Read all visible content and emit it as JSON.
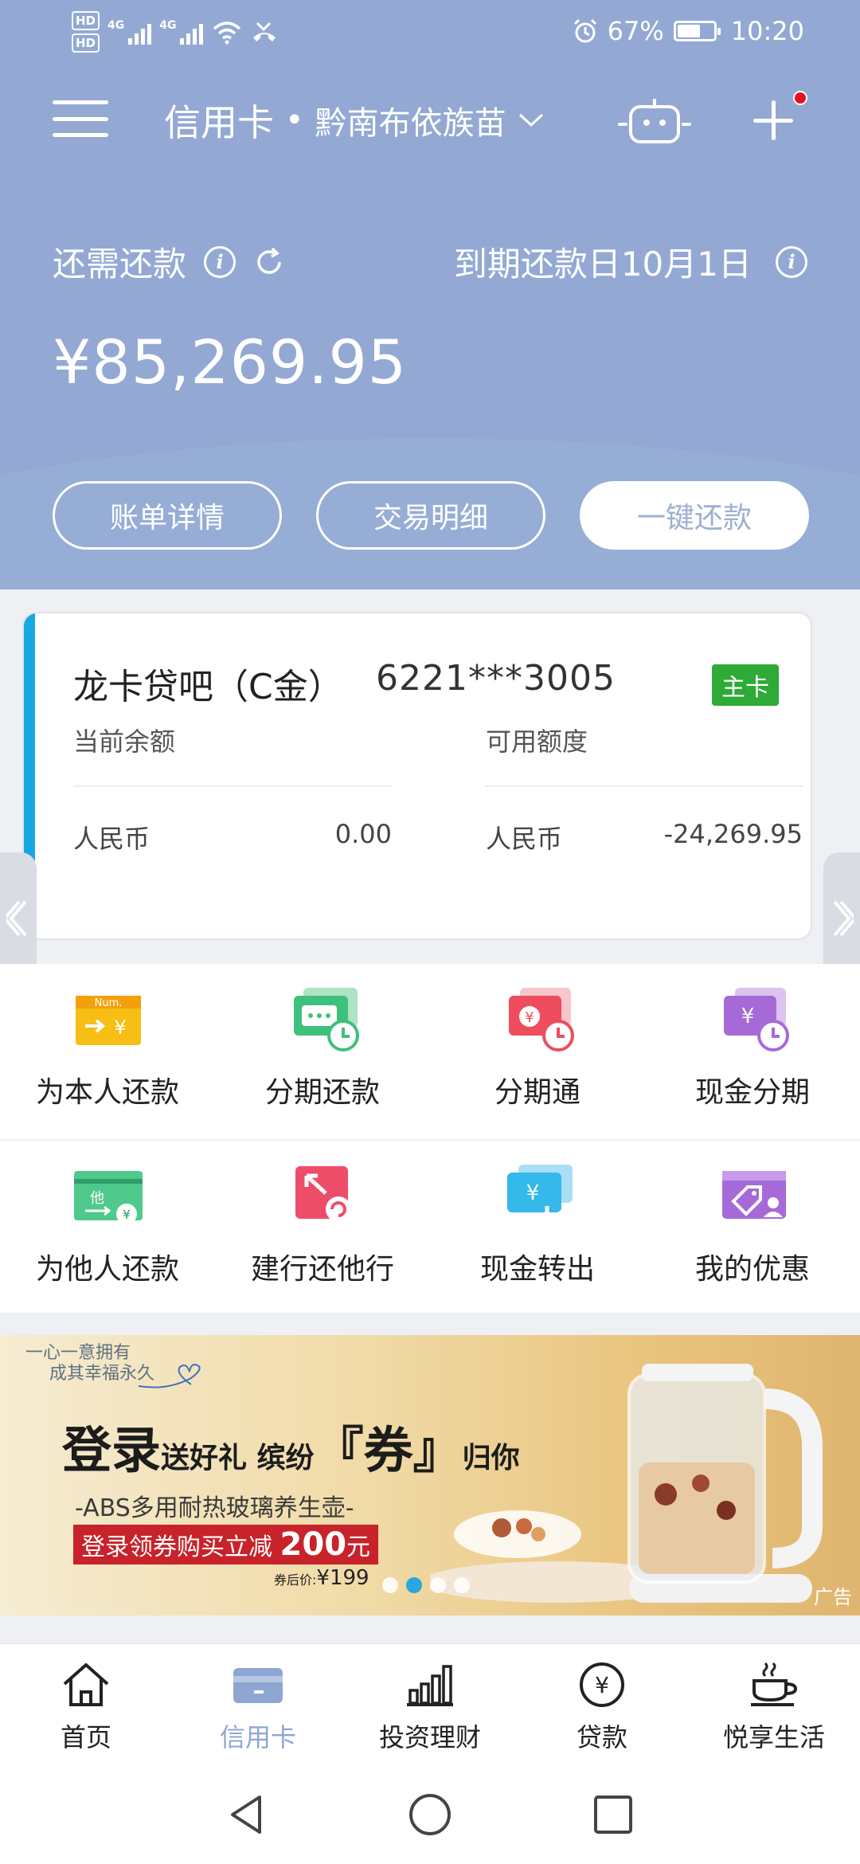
{
  "status_bar": {
    "hd1": "HD",
    "hd2": "HD",
    "network1": "4G",
    "network2": "4G",
    "battery": "67%",
    "time": "10:20"
  },
  "header": {
    "title": "信用卡",
    "separator": "•",
    "region": "黔南布依族苗",
    "due_label": "还需还款",
    "due_date": "到期还款日10月1日",
    "amount": "¥85,269.95",
    "buttons": {
      "bill_detail": "账单详情",
      "transactions": "交易明细",
      "pay_now": "一键还款"
    }
  },
  "card": {
    "name": "龙卡贷吧（C金）",
    "number": "6221***3005",
    "badge": "主卡",
    "current_balance_label": "当前余额",
    "available_credit_label": "可用额度",
    "currency": "人民币",
    "current_balance": "0.00",
    "available_credit": "-24,269.95",
    "accent_color": "#16a8e0"
  },
  "services": [
    {
      "label": "为本人还款",
      "icon": "self-repay-icon"
    },
    {
      "label": "分期还款",
      "icon": "installment-repay-icon"
    },
    {
      "label": "分期通",
      "icon": "installment-pass-icon"
    },
    {
      "label": "现金分期",
      "icon": "cash-installment-icon"
    },
    {
      "label": "为他人还款",
      "icon": "others-repay-icon"
    },
    {
      "label": "建行还他行",
      "icon": "repay-other-bank-icon"
    },
    {
      "label": "现金转出",
      "icon": "cash-transfer-icon"
    },
    {
      "label": "我的优惠",
      "icon": "my-offers-icon"
    }
  ],
  "banner": {
    "slogan_line1": "一心一意拥有",
    "slogan_line2": "成其幸福永久",
    "headline_big1": "登录",
    "headline_small1": "送好礼 缤纷",
    "headline_big2": "『券』",
    "headline_small2": "归你",
    "product": "-ABS多用耐热玻璃养生壶-",
    "offer_prefix": "登录领券购买立减",
    "offer_amount": "200",
    "offer_suffix": "元",
    "price_label": "券后价:",
    "price": "¥199",
    "ad_tag": "广告"
  },
  "tabs": [
    {
      "label": "首页",
      "icon": "home-icon"
    },
    {
      "label": "信用卡",
      "icon": "credit-card-icon",
      "active": true
    },
    {
      "label": "投资理财",
      "icon": "investment-chart-icon"
    },
    {
      "label": "贷款",
      "icon": "loan-yen-icon"
    },
    {
      "label": "悦享生活",
      "icon": "coffee-cup-icon"
    }
  ],
  "colors": {
    "header_bg": "#93a9d4",
    "active_tab": "#8ea6d2",
    "badge_green": "#2eaa36",
    "notification_red": "#e0141c"
  }
}
